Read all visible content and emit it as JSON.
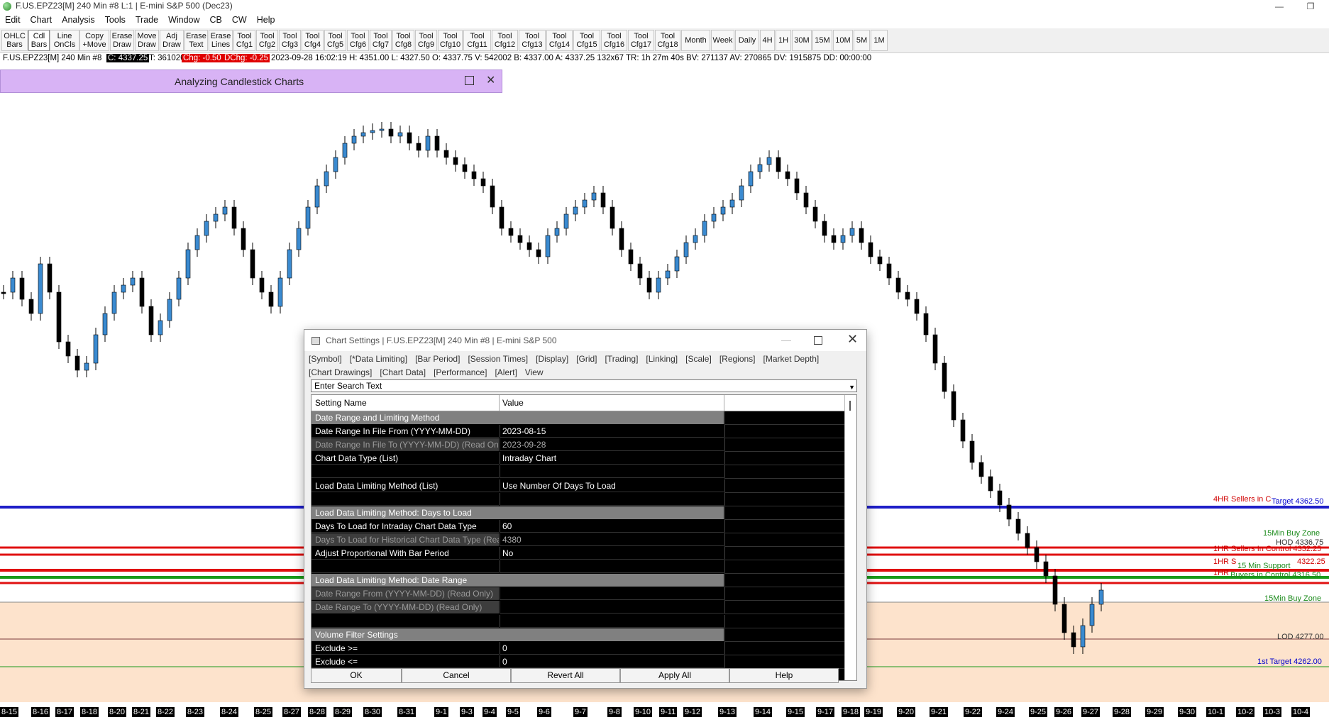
{
  "window": {
    "title": "F.US.EPZ23[M]  240 Min  #8 L:1  |  E-mini S&P 500 (Dec23)"
  },
  "menu": [
    "Edit",
    "Chart",
    "Analysis",
    "Tools",
    "Trade",
    "Window",
    "CB",
    "CW",
    "Help"
  ],
  "toolbar": {
    "buttons": [
      "OHLC\nBars",
      "Cdl\nBars",
      "Line\nOnCls",
      "Copy\n+Move",
      "Erase\nDraw",
      "Move\nDraw",
      "Adj\nDraw",
      "Erase\nText",
      "Erase\nLines",
      "Tool\nCfg1",
      "Tool\nCfg2",
      "Tool\nCfg3",
      "Tool\nCfg4",
      "Tool\nCfg5",
      "Tool\nCfg6",
      "Tool\nCfg7",
      "Tool\nCfg8",
      "Tool\nCfg9",
      "Tool\nCfg10",
      "Tool\nCfg11",
      "Tool\nCfg12",
      "Tool\nCfg13",
      "Tool\nCfg14",
      "Tool\nCfg15",
      "Tool\nCfg16",
      "Tool\nCfg17",
      "Tool\nCfg18",
      "Month",
      "Week",
      "Daily",
      "4H",
      "1H",
      "30M",
      "15M",
      "10M",
      "5M",
      "1M"
    ]
  },
  "status": {
    "symbol": "F.US.EPZ23[M]  240 Min  #8",
    "close": "C: 4337.25",
    "ticks": "T: 361026",
    "chg": "Chg: -0.50",
    "dchg": "DChg: -0.25",
    "rest": "2023-09-28 16:02:19 H: 4351.00 L: 4327.50 O: 4337.75 V: 542002 B: 4337.00 A: 4337.25 132x67 TR: 1h 27m 40s BV: 271137 AV: 270865 DV: 1915875 DD: 00:00:00"
  },
  "study_window": {
    "title": "Analyzing Candlestick Charts"
  },
  "chart": {
    "levels": [
      {
        "label": "4HR Sellers in C",
        "color": "#d00000"
      },
      {
        "label": "Target  4362.50",
        "color": "#0000cc"
      },
      {
        "label": "15Min  Buy Zone",
        "color": "#1a8a1a"
      },
      {
        "label": "HOD  4336.75",
        "color": "#333333"
      },
      {
        "label": "1HR Sellers In Control  4332.25",
        "color": "#d00000"
      },
      {
        "label": "1HR S",
        "color": "#d00000"
      },
      {
        "label": "4322.25",
        "color": "#d00000"
      },
      {
        "label": "15 Min Support",
        "color": "#1a8a1a"
      },
      {
        "label": "1HR",
        "color": "#d00000"
      },
      {
        "label": "Buyers in Control  4316.50",
        "color": "#1a8a1a"
      },
      {
        "label": "15Min Buy Zone",
        "color": "#1a8a1a"
      },
      {
        "label": "LOD  4277.00",
        "color": "#333333"
      },
      {
        "label": "1st Target  4262.00",
        "color": "#0000cc"
      }
    ],
    "x_labels": [
      "8-15",
      "8-16",
      "8-17",
      "8-18",
      "8-20",
      "8-21",
      "8-22",
      "8-23",
      "8-24",
      "8-25",
      "8-27",
      "8-28",
      "8-29",
      "8-30",
      "8-31",
      "9-1",
      "9-3",
      "9-4",
      "9-5",
      "9-6",
      "9-7",
      "9-8",
      "9-10",
      "9-11",
      "9-12",
      "9-13",
      "9-14",
      "9-15",
      "9-17",
      "9-18",
      "9-19",
      "9-20",
      "9-21",
      "9-22",
      "9-24",
      "9-25",
      "9-26",
      "9-27",
      "9-28",
      "9-29",
      "9-30",
      "10-1",
      "10-2",
      "10-3",
      "10-4"
    ]
  },
  "dialog": {
    "title": "Chart Settings | F.US.EPZ23[M]  240 Min  #8 | E-mini S&P 500",
    "tabs": [
      "[Symbol]",
      "[*Data Limiting]",
      "[Bar Period]",
      "[Session Times]",
      "[Display]",
      "[Grid]",
      "[Trading]",
      "[Linking]",
      "[Scale]",
      "[Regions]",
      "[Market Depth]",
      "[Chart Drawings]",
      "[Chart Data]",
      "[Performance]",
      "[Alert]",
      "View"
    ],
    "search_placeholder": "Enter Search Text",
    "col_name": "Setting Name",
    "col_value": "Value",
    "rows": [
      {
        "name": "Date Range and Limiting Method",
        "value": "",
        "kind": "section"
      },
      {
        "name": "Date Range In File From (YYYY-MM-DD)",
        "value": "2023-08-15",
        "kind": "normal"
      },
      {
        "name": "Date Range In File To (YYYY-MM-DD) (Read Only)",
        "value": "2023-09-28",
        "kind": "readonly"
      },
      {
        "name": "Chart Data Type (List)",
        "value": "Intraday Chart",
        "kind": "normal"
      },
      {
        "name": "",
        "value": "",
        "kind": "blank"
      },
      {
        "name": "Load Data Limiting Method (List)",
        "value": "Use Number Of Days To Load",
        "kind": "normal"
      },
      {
        "name": "",
        "value": "",
        "kind": "blank"
      },
      {
        "name": "Load Data Limiting Method: Days to Load",
        "value": "",
        "kind": "section"
      },
      {
        "name": "Days To Load for Intraday Chart Data Type",
        "value": "60",
        "kind": "normal"
      },
      {
        "name": "Days To Load for Historical Chart Data Type (Read Only)",
        "value": "4380",
        "kind": "readonly"
      },
      {
        "name": "Adjust Proportional With Bar Period",
        "value": "No",
        "kind": "normal"
      },
      {
        "name": "",
        "value": "",
        "kind": "blank"
      },
      {
        "name": "Load Data Limiting Method: Date Range",
        "value": "",
        "kind": "section"
      },
      {
        "name": "Date Range From (YYYY-MM-DD) (Read Only)",
        "value": "",
        "kind": "readonly"
      },
      {
        "name": "Date Range To (YYYY-MM-DD) (Read Only)",
        "value": "",
        "kind": "readonly"
      },
      {
        "name": "",
        "value": "",
        "kind": "blank"
      },
      {
        "name": "Volume Filter Settings",
        "value": "",
        "kind": "section"
      },
      {
        "name": "Exclude >=",
        "value": "0",
        "kind": "normal"
      },
      {
        "name": "Exclude <=",
        "value": "0",
        "kind": "normal"
      }
    ],
    "buttons": {
      "ok": "OK",
      "cancel": "Cancel",
      "revert": "Revert All",
      "apply": "Apply All",
      "help": "Help"
    }
  }
}
